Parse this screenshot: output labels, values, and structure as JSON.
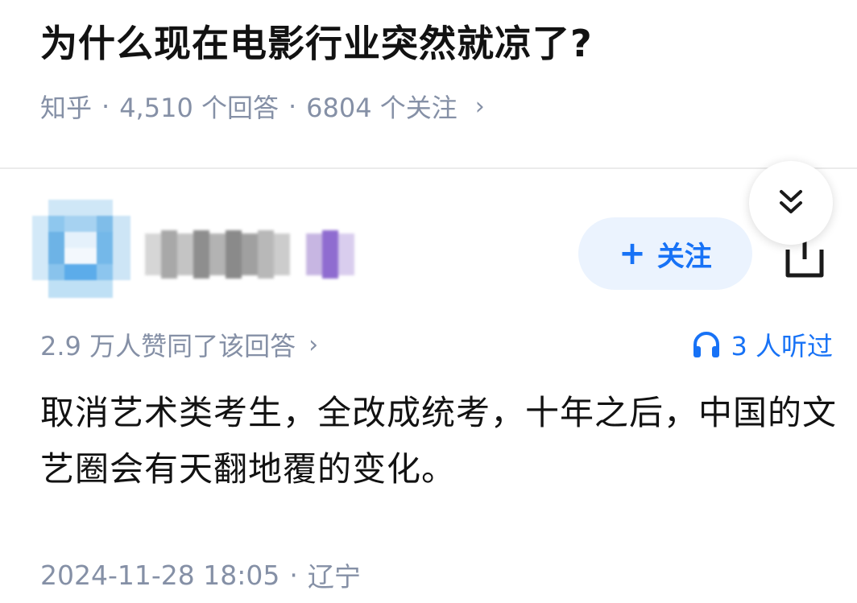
{
  "question": {
    "title": "为什么现在电影行业突然就凉了?",
    "source": "知乎",
    "answers": "4,510 个回答",
    "followers": "6804 个关注",
    "separator": "·",
    "chevron": "›"
  },
  "author": {
    "follow_label": "关注",
    "follow_plus": "+"
  },
  "answer": {
    "votes": "2.9 万人赞同了该回答",
    "listened": "3 人听过",
    "content": "取消艺术类考生，全改成统考，十年之后，中国的文艺圈会有天翻地覆的变化。",
    "date": "2024-11-28 18:05",
    "location": "辽宁"
  },
  "icons": {
    "collapse": "double-chevron-down-icon",
    "share": "share-icon",
    "headphones": "headphones-icon"
  },
  "colors": {
    "accent": "#1772f6",
    "meta_text": "#8590a6",
    "follow_bg": "#ebf3fe",
    "title": "#121212"
  }
}
